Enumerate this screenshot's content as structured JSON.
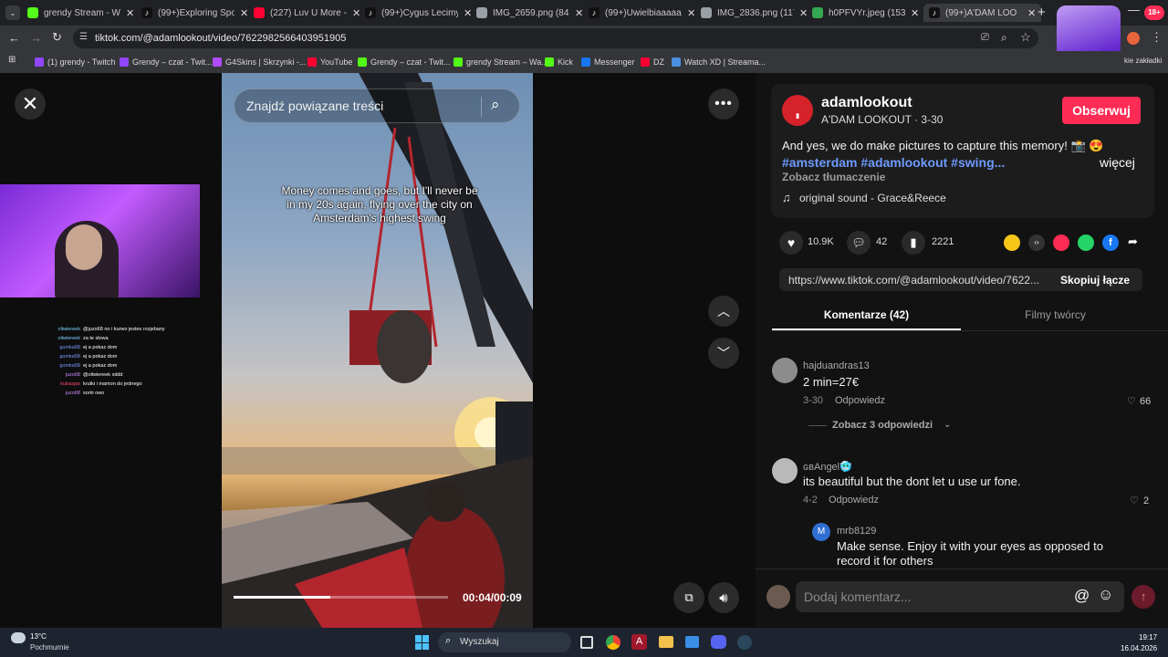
{
  "browser": {
    "tabs": [
      {
        "label": "grendy Stream - Wat",
        "icon": "kick-icon",
        "color": "#53fc18"
      },
      {
        "label": "(99+)Exploring Spong",
        "icon": "tiktok-icon",
        "color": "#ffffff"
      },
      {
        "label": "(227) Luv U More - Yo",
        "icon": "youtube-icon",
        "color": "#ff0033"
      },
      {
        "label": "(99+)Cygus Lecimy d",
        "icon": "tiktok-icon",
        "color": "#ffffff"
      },
      {
        "label": "IMG_2659.png (845×",
        "icon": "globe-icon",
        "color": "#9aa0a6"
      },
      {
        "label": "(99+)Uwielbiaaaaaaa",
        "icon": "tiktok-icon",
        "color": "#ffffff"
      },
      {
        "label": "IMG_2836.png (1179",
        "icon": "globe-icon",
        "color": "#9aa0a6"
      },
      {
        "label": "h0PFVYr.jpeg (1534×",
        "icon": "image-icon",
        "color": "#34a853"
      },
      {
        "label": "(99+)A'DAM LOO",
        "icon": "tiktok-icon",
        "color": "#ffffff"
      }
    ],
    "url": "tiktok.com/@adamlookout/video/7622982566403951905",
    "bookmarks": [
      {
        "label": "(1) grendy - Twitch",
        "color": "#9146ff"
      },
      {
        "label": "Grendy – czat - Twit...",
        "color": "#9146ff"
      },
      {
        "label": "G4Skins | Skrzynki -...",
        "color": "#b14bff"
      },
      {
        "label": "YouTube",
        "color": "#ff0033"
      },
      {
        "label": "Grendy – czat - Twit...",
        "color": "#53fc18"
      },
      {
        "label": "grendy Stream – Wa...",
        "color": "#53fc18"
      },
      {
        "label": "Kick",
        "color": "#53fc18"
      },
      {
        "label": "Messenger",
        "color": "#1877f2"
      },
      {
        "label": "DZ",
        "color": "#ff0033"
      },
      {
        "label": "Watch XD | Streama...",
        "color": "#4a90e2"
      }
    ],
    "all_bookmarks_label": "kie zakładki"
  },
  "stream_chat": [
    {
      "user": "oliwiereek",
      "msg": "@juzo68 no i kurwo jestes rozjebany",
      "color": "#7fd1ff"
    },
    {
      "user": "oliwiereek",
      "msg": "za te slowa",
      "color": "#7fd1ff"
    },
    {
      "user": "gumka58",
      "msg": "ej a pokaz dom",
      "color": "#7e9bff"
    },
    {
      "user": "gumka58",
      "msg": "ej a pokaz dom",
      "color": "#7e9bff"
    },
    {
      "user": "gumka58",
      "msg": "ej a pokaz dom",
      "color": "#7e9bff"
    },
    {
      "user": "juzo68",
      "msg": "@oliwiereek xddd",
      "color": "#d28cff"
    },
    {
      "user": "kubaspiz",
      "msg": "krutki i mamon do jednego",
      "color": "#ff4d6d"
    },
    {
      "user": "juzo68",
      "msg": "sorki owo",
      "color": "#d28cff"
    }
  ],
  "video": {
    "search_placeholder": "Znajdź powiązane treści",
    "caption": "Money comes and goes, but I'll never be in my 20s again, flying over the city on Amsterdam's highest swing",
    "time": "00:04/00:09",
    "progress": 0.45
  },
  "post": {
    "username": "adamlookout",
    "subtitle": "A'DAM LOOKOUT · 3-30",
    "follow": "Obserwuj",
    "description": "And yes, we do make pictures to capture this memory! 📸 😍",
    "hashtags": "#amsterdam #adamlookout #swing...",
    "more": "więcej",
    "translate": "Zobacz tłumaczenie",
    "sound": "original sound - Grace&Reece",
    "likes": "10.9K",
    "comments": "42",
    "saves": "2221",
    "link": "https://www.tiktok.com/@adamlookout/video/7622...",
    "copy": "Skopiuj łącze"
  },
  "tabs": {
    "comments": "Komentarze (42)",
    "creator": "Filmy twórcy"
  },
  "comments": [
    {
      "user": "hajduandras13",
      "text": "2 min=27€",
      "date": "3-30",
      "reply": "Odpowiedz",
      "likes": "66",
      "view_replies": "Zobacz 3 odpowiedzi"
    },
    {
      "user": "ɢʙAngel🥶",
      "text": "its beautiful but the dont let u use ur fone.",
      "date": "4-2",
      "reply": "Odpowiedz",
      "likes": "2"
    },
    {
      "user": "mrb8129",
      "text": "Make sense. Enjoy it with your eyes as opposed to record it for others",
      "avatar_letter": "M"
    }
  ],
  "comment_input": {
    "placeholder": "Dodaj komentarz..."
  },
  "taskbar": {
    "temp": "13°C",
    "weather": "Pochmurnie",
    "search": "Wyszukaj",
    "time": "19:17",
    "date": "16.04.2026"
  }
}
